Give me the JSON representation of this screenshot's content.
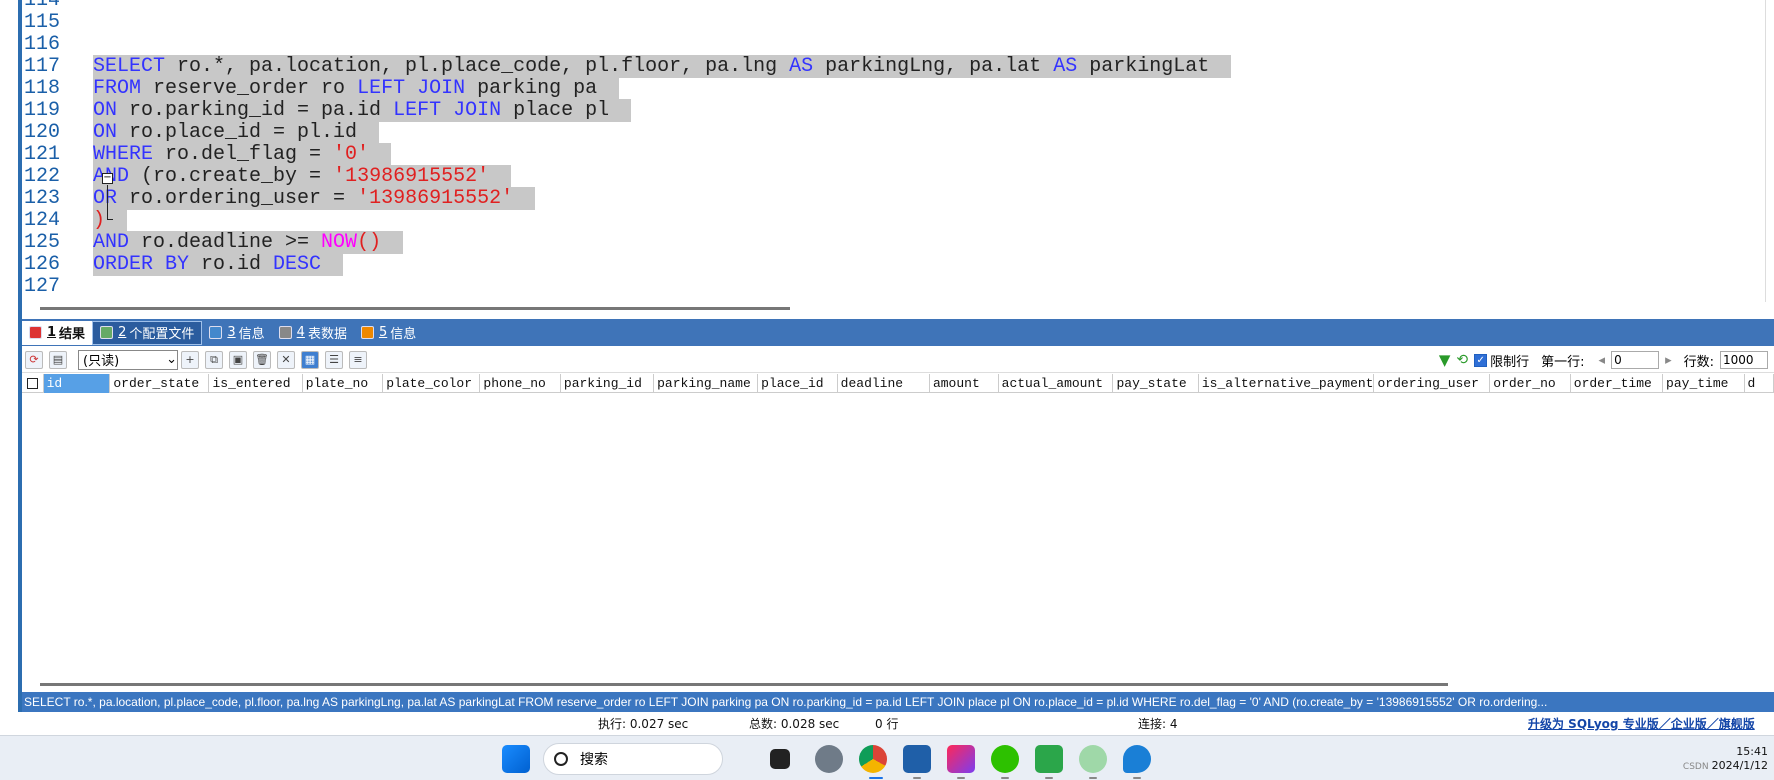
{
  "editor": {
    "line_numbers": [
      "114",
      "115",
      "116",
      "117",
      "118",
      "119",
      "120",
      "121",
      "122",
      "123",
      "124",
      "125",
      "126",
      "127"
    ],
    "lines": [
      [],
      [],
      [],
      [
        {
          "t": "SELECT",
          "c": "kw"
        },
        {
          "t": " ro.*, pa.location, pl.place_code, pl.floor, pa.lng ",
          "c": ""
        },
        {
          "t": "AS",
          "c": "kw"
        },
        {
          "t": " parkingLng, pa.lat ",
          "c": ""
        },
        {
          "t": "AS",
          "c": "kw"
        },
        {
          "t": " parkingLat",
          "c": ""
        }
      ],
      [
        {
          "t": "FROM",
          "c": "kw"
        },
        {
          "t": " reserve_order ro ",
          "c": ""
        },
        {
          "t": "LEFT JOIN",
          "c": "kw"
        },
        {
          "t": " parking pa",
          "c": ""
        }
      ],
      [
        {
          "t": "ON",
          "c": "kw"
        },
        {
          "t": " ro.parking_id = pa.id ",
          "c": ""
        },
        {
          "t": "LEFT JOIN",
          "c": "kw"
        },
        {
          "t": " place pl",
          "c": ""
        }
      ],
      [
        {
          "t": "ON",
          "c": "kw"
        },
        {
          "t": " ro.place_id = pl.id",
          "c": ""
        }
      ],
      [
        {
          "t": "WHERE",
          "c": "kw"
        },
        {
          "t": " ro.del_flag = ",
          "c": ""
        },
        {
          "t": "'0'",
          "c": "str"
        }
      ],
      [
        {
          "t": "AND",
          "c": "kw"
        },
        {
          "t": " (ro.create_by = ",
          "c": ""
        },
        {
          "t": "'13986915552'",
          "c": "str"
        }
      ],
      [
        {
          "t": "OR",
          "c": "kw"
        },
        {
          "t": " ro.ordering_user = ",
          "c": ""
        },
        {
          "t": "'13986915552'",
          "c": "str"
        }
      ],
      [
        {
          "t": ")",
          "c": "str"
        }
      ],
      [
        {
          "t": "AND",
          "c": "kw"
        },
        {
          "t": " ro.deadline >= ",
          "c": ""
        },
        {
          "t": "NOW",
          "c": "fn"
        },
        {
          "t": "()",
          "c": "str"
        }
      ],
      [
        {
          "t": "ORDER BY",
          "c": "kw"
        },
        {
          "t": " ro.id ",
          "c": ""
        },
        {
          "t": "DESC",
          "c": "kw"
        }
      ],
      []
    ]
  },
  "tabs": [
    {
      "num": "1",
      "label": "结果",
      "state": "active"
    },
    {
      "num": "2",
      "label": "个配置文件",
      "state": "sel"
    },
    {
      "num": "3",
      "label": "信息",
      "state": ""
    },
    {
      "num": "4",
      "label": "表数据",
      "state": ""
    },
    {
      "num": "5",
      "label": "信息",
      "state": ""
    }
  ],
  "toolbar": {
    "mode_select": "(只读)",
    "limit_rows_label": "限制行",
    "first_row_label": "第一行:",
    "first_row_value": "0",
    "rows_label": "行数:",
    "rows_value": "1000"
  },
  "grid": {
    "columns": [
      "id",
      "order_state",
      "is_entered",
      "plate_no",
      "plate_color",
      "phone_no",
      "parking_id",
      "parking_name",
      "place_id",
      "deadline",
      "amount",
      "actual_amount",
      "pay_state",
      "is_alternative_payment",
      "ordering_user",
      "order_no",
      "order_time",
      "pay_time",
      "d"
    ]
  },
  "status": {
    "sql": "SELECT ro.*, pa.location, pl.place_code, pl.floor, pa.lng AS parkingLng, pa.lat AS parkingLat FROM reserve_order ro LEFT JOIN parking pa ON ro.parking_id = pa.id LEFT JOIN place pl ON ro.place_id = pl.id WHERE ro.del_flag = '0' AND (ro.create_by = '13986915552' OR ro.ordering...",
    "exec": "执行: 0.027 sec",
    "total": "总数: 0.028 sec",
    "rows": "0 行",
    "conn": "连接: 4",
    "upgrade": "升级为 SQLyog 专业版／企业版／旗舰版"
  },
  "taskbar": {
    "search_placeholder": "搜索",
    "time": "15:41",
    "date": "2024/1/12",
    "watermark": "CSDN"
  }
}
